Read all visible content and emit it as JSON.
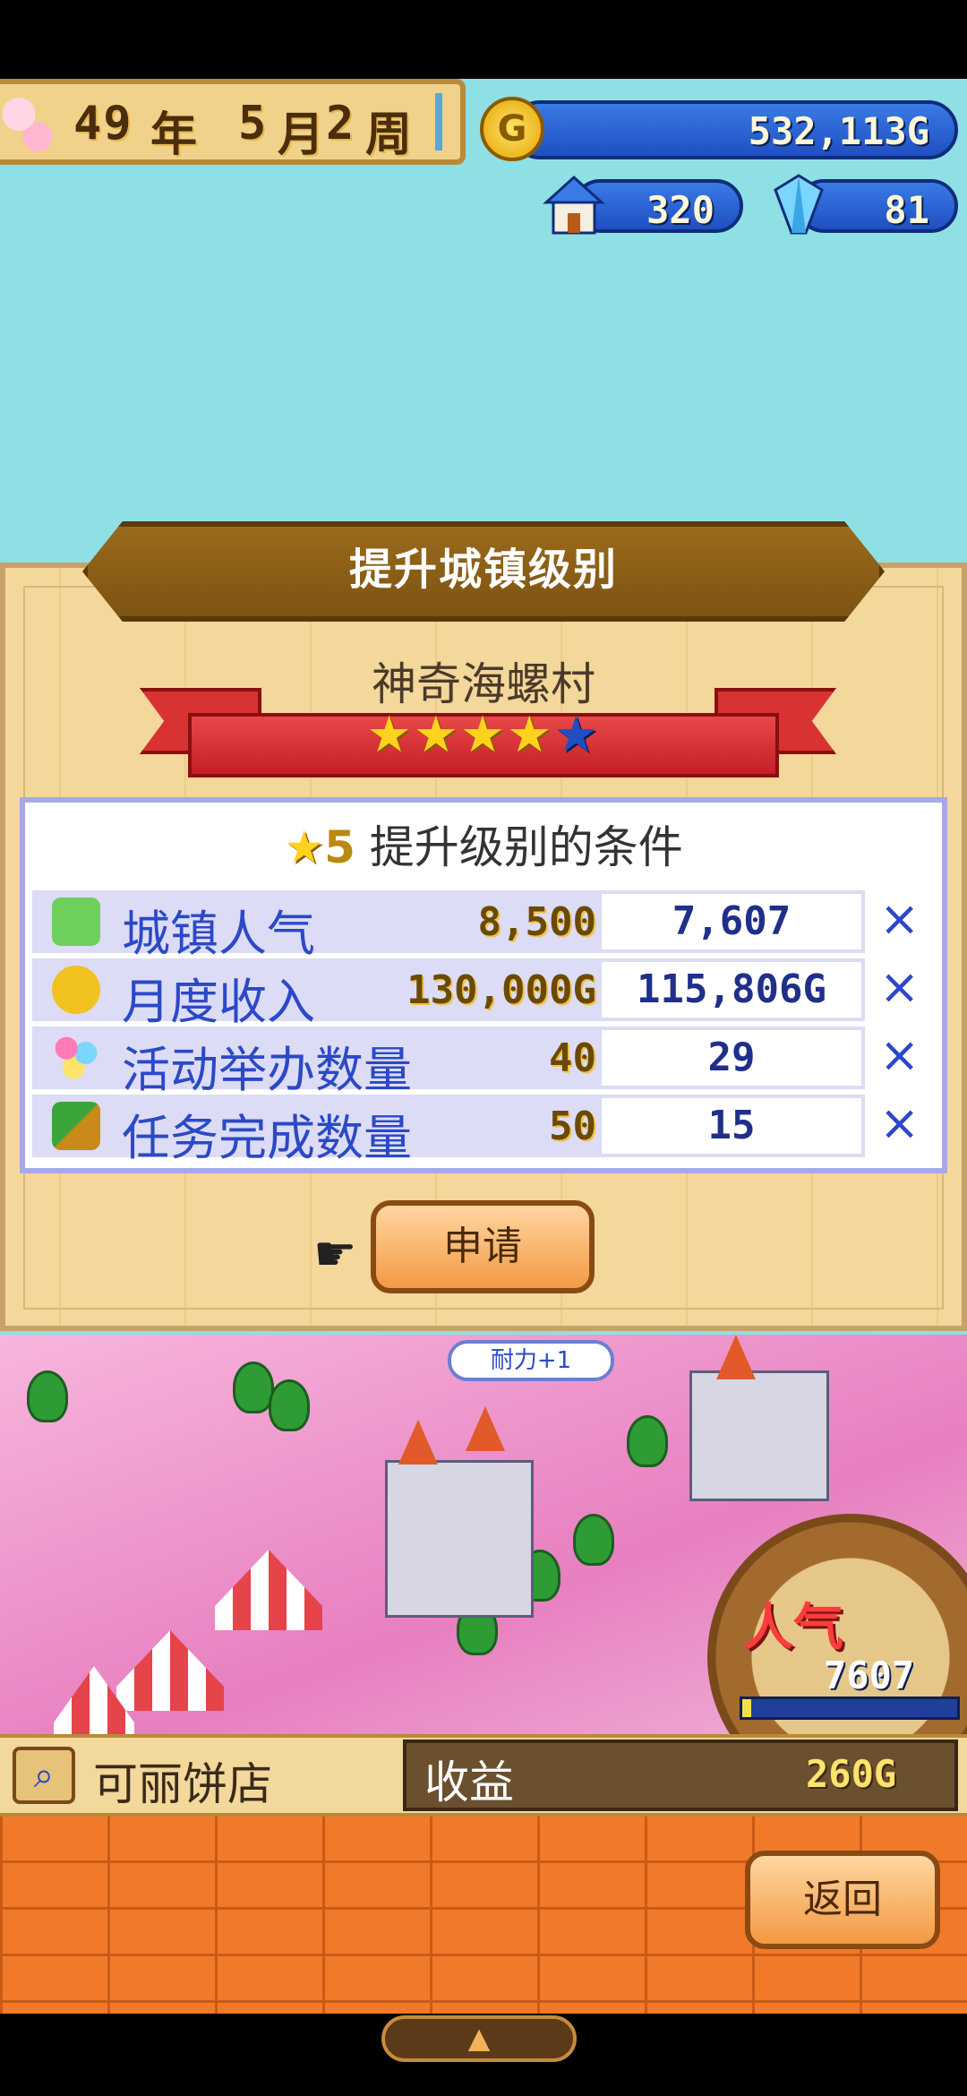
{
  "hud": {
    "year_value": "49",
    "year_unit": "年",
    "month_value": "5",
    "month_unit": "月",
    "week_value": "2",
    "week_unit": "周",
    "money": "532,113G",
    "coin_glyph": "G",
    "houses": "320",
    "crystals": "81"
  },
  "dialog": {
    "title": "提升城镇级别",
    "town_name": "神奇海螺村",
    "stars_filled": 4,
    "stars_total": 5,
    "conditions_level": "5",
    "conditions_title": "提升级别的条件",
    "rows": [
      {
        "label": "城镇人气",
        "required": "8,500",
        "current": "7,607",
        "met": "×"
      },
      {
        "label": "月度收入",
        "required": "130,000G",
        "current": "115,806G",
        "met": "×"
      },
      {
        "label": "活动举办数量",
        "required": "40",
        "current": "29",
        "met": "×"
      },
      {
        "label": "任务完成数量",
        "required": "50",
        "current": "15",
        "met": "×"
      }
    ],
    "apply_label": "申请"
  },
  "map": {
    "stamina_text": "耐力+1",
    "popularity_label": "人气",
    "popularity_value": "7607",
    "popularity_fill": 0.04
  },
  "info": {
    "shop_name": "可丽饼店",
    "income_label": "收益",
    "income_value": "260G"
  },
  "back_label": "返回",
  "expand_glyph": "▲",
  "colors": {
    "accent_blue": "#2b49c7",
    "button_orange": "#f29a44",
    "ribbon_red": "#d83232"
  }
}
